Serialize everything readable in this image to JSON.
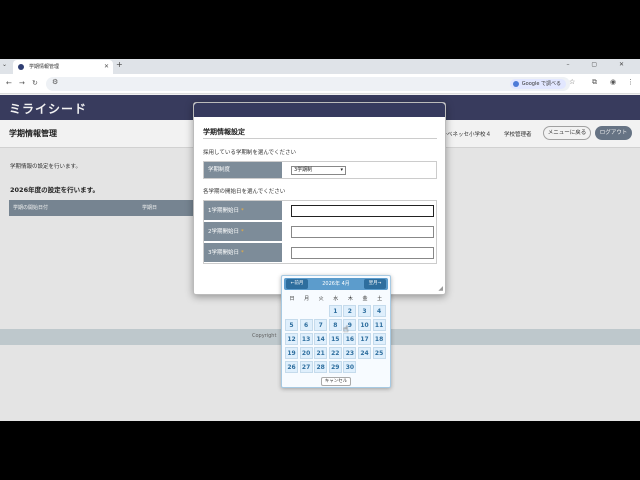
{
  "browser": {
    "tab_title": "学期情報管理",
    "google_search_label": "Google で調べる"
  },
  "app": {
    "logo_text": "ミライシード",
    "page_title": "学期情報管理",
    "school_name": "第一ベネッセ小学校４",
    "user_role": "学校管理者",
    "menu_button": "メニューに戻る",
    "logout_button": "ログアウト"
  },
  "main": {
    "intro_text": "学期情報の設定を行います。",
    "year_note": "2026年度の設定を行います。",
    "table_headers": [
      "学期の開始日付",
      "学期日"
    ]
  },
  "footer": {
    "copyright": "Copyright"
  },
  "modal": {
    "title": "学期情報設定",
    "question_term_system": "採用している学期制を選んでください",
    "term_system_label": "学期制度",
    "term_system_value": "3学期制",
    "question_start_dates": "各学期の開始日を選んでください",
    "date_rows": [
      {
        "label": "1学期開始日",
        "required_mark": "*"
      },
      {
        "label": "2学期開始日",
        "required_mark": "*"
      },
      {
        "label": "3学期開始日",
        "required_mark": "*"
      }
    ]
  },
  "datepicker": {
    "prev_label": "←前月",
    "next_label": "翌月→",
    "month_title": "2026年 4月",
    "weekdays": [
      "日",
      "月",
      "火",
      "水",
      "木",
      "金",
      "土"
    ],
    "weeks": [
      [
        "",
        "",
        "",
        "1",
        "2",
        "3",
        "4"
      ],
      [
        "5",
        "6",
        "7",
        "8",
        "9",
        "10",
        "11"
      ],
      [
        "12",
        "13",
        "14",
        "15",
        "16",
        "17",
        "18"
      ],
      [
        "19",
        "20",
        "21",
        "22",
        "23",
        "24",
        "25"
      ],
      [
        "26",
        "27",
        "28",
        "29",
        "30",
        "",
        ""
      ]
    ],
    "cancel_label": "キャンセル"
  }
}
